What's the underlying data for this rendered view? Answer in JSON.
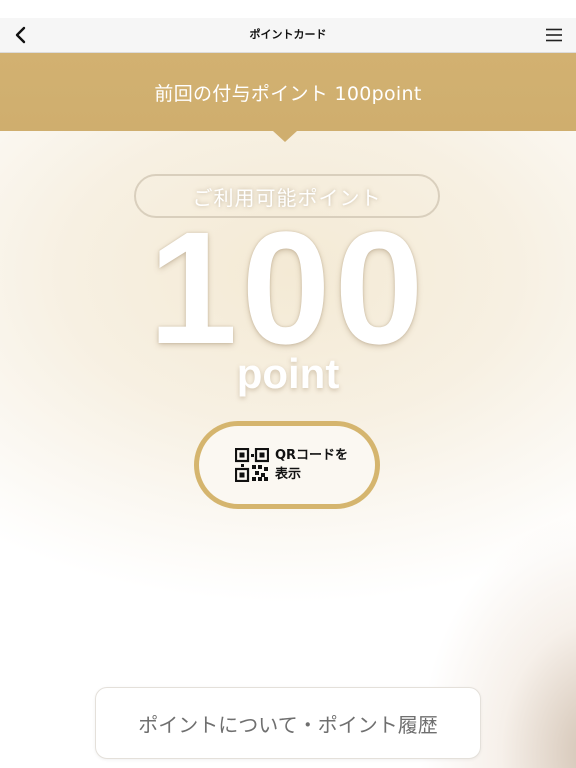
{
  "header": {
    "title": "ポイントカード",
    "back_icon": "chevron-left-icon",
    "menu_icon": "hamburger-menu-icon"
  },
  "banner": {
    "text": "前回の付与ポイント 100point",
    "color": "#cfae6e"
  },
  "points": {
    "available_label": "ご利用可能ポイント",
    "value": "100",
    "unit": "point"
  },
  "qr_button": {
    "label": "QRコードを\n表示",
    "icon": "qr-code-icon",
    "border_color": "#d5b56e"
  },
  "history_button": {
    "label": "ポイントについて・ポイント履歴"
  }
}
